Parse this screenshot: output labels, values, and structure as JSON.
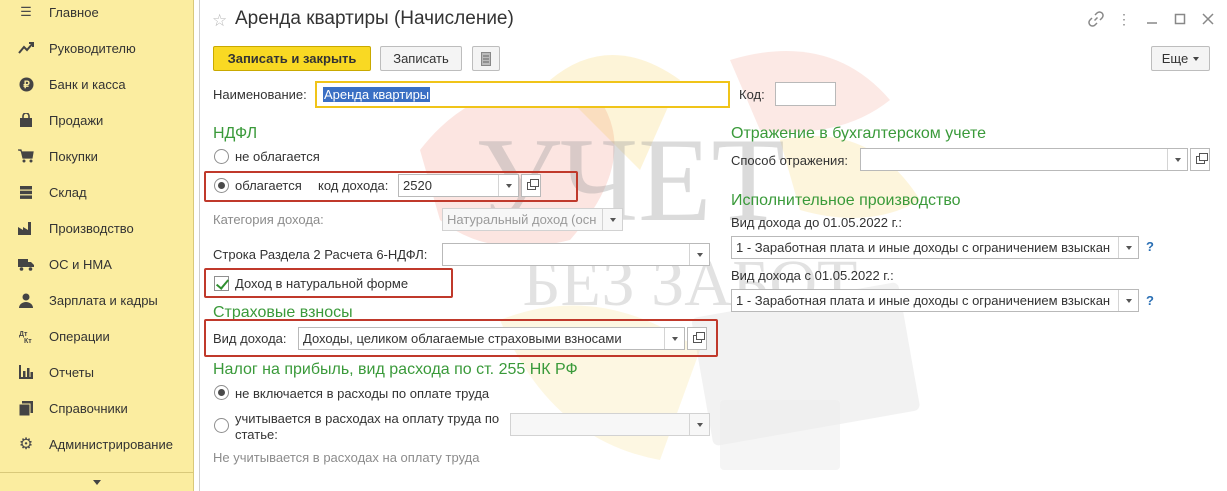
{
  "sidebar": {
    "items": [
      {
        "label": "Главное",
        "icon": "menu-icon"
      },
      {
        "label": "Руководителю",
        "icon": "chart-up-icon"
      },
      {
        "label": "Банк и касса",
        "icon": "ruble-icon"
      },
      {
        "label": "Продажи",
        "icon": "bag-icon"
      },
      {
        "label": "Покупки",
        "icon": "cart-icon"
      },
      {
        "label": "Склад",
        "icon": "warehouse-icon"
      },
      {
        "label": "Производство",
        "icon": "factory-icon"
      },
      {
        "label": "ОС и НМА",
        "icon": "truck-icon"
      },
      {
        "label": "Зарплата и кадры",
        "icon": "person-icon"
      },
      {
        "label": "Операции",
        "icon": "debit-credit-icon"
      },
      {
        "label": "Отчеты",
        "icon": "bar-chart-icon"
      },
      {
        "label": "Справочники",
        "icon": "book-icon"
      },
      {
        "label": "Администрирование",
        "icon": "gear-icon"
      }
    ]
  },
  "form": {
    "title": "Аренда квартиры (Начисление)",
    "toolbar": {
      "save_close": "Записать и закрыть",
      "save": "Записать",
      "more": "Еще"
    },
    "name_label": "Наименование:",
    "name_value": "Аренда квартиры",
    "code_label": "Код:",
    "code_value": "",
    "ndfl": {
      "title": "НДФЛ",
      "not_taxed": "не облагается",
      "taxed": "облагается",
      "income_code_label": "код дохода:",
      "income_code": "2520",
      "category_label": "Категория дохода:",
      "category_value": "Натуральный доход (осн",
      "row_label": "Строка Раздела 2 Расчета 6-НДФЛ:",
      "row_value": "",
      "natural_label": "Доход в натуральной форме"
    },
    "insurance": {
      "title": "Страховые взносы",
      "income_type_label": "Вид дохода:",
      "income_type_value": "Доходы, целиком облагаемые страховыми взносами"
    },
    "profit_tax": {
      "title": "Налог на прибыль, вид расхода по ст. 255 НК РФ",
      "opt1": "не включается в расходы по оплате труда",
      "opt2_line1": "учитывается в расходах на оплату труда по",
      "opt2_line2": "статье:",
      "note": "Не учитывается в расходах на оплату труда"
    },
    "accounting": {
      "title": "Отражение в бухгалтерском учете",
      "method_label": "Способ отражения:",
      "method_value": ""
    },
    "enforcement": {
      "title": "Исполнительное производство",
      "before_label": "Вид дохода до 01.05.2022 г.:",
      "before_value": "1 - Заработная плата и иные доходы с ограничением взыскан",
      "after_label": "Вид дохода с 01.05.2022 г.:",
      "after_value": "1 - Заработная плата и иные доходы с ограничением взыскан",
      "help": "?"
    },
    "watermark": {
      "line1": "УЧЕТ",
      "line2": "БЕЗ ЗАБОТ"
    }
  }
}
